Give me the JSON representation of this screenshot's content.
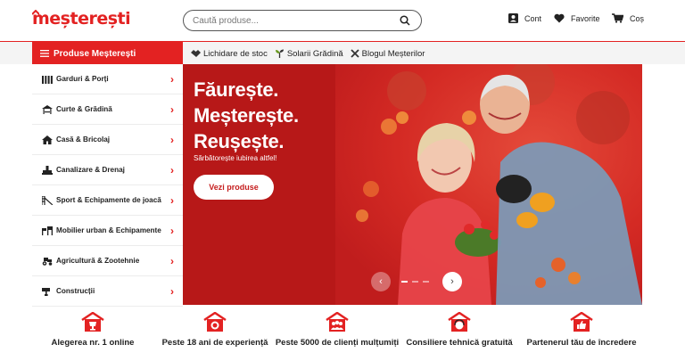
{
  "header": {
    "logo_text": "meșterești",
    "search_placeholder": "Caută produse...",
    "links": {
      "account": "Cont",
      "favorites": "Favorite",
      "cart": "Coș"
    }
  },
  "nav": {
    "categories_button": "Produse Meșterești",
    "links": [
      "Lichidare de stoc",
      "Solarii Grădină",
      "Blogul Meșterilor"
    ]
  },
  "sidebar": {
    "items": [
      {
        "label": "Garduri & Porți",
        "icon": "fence-icon"
      },
      {
        "label": "Curte & Grădină",
        "icon": "gazebo-icon"
      },
      {
        "label": "Casă & Bricolaj",
        "icon": "house-icon"
      },
      {
        "label": "Canalizare & Drenaj",
        "icon": "pipe-icon"
      },
      {
        "label": "Sport & Echipamente de joacă",
        "icon": "playground-icon"
      },
      {
        "label": "Mobilier urban & Echipamente",
        "icon": "bench-icon"
      },
      {
        "label": "Agricultură & Zootehnie",
        "icon": "tractor-icon"
      },
      {
        "label": "Construcții",
        "icon": "trowel-icon"
      }
    ]
  },
  "hero": {
    "title_lines": [
      "Făurește.",
      "Meșterește.",
      "Reușește."
    ],
    "subtitle": "Sărbătorește iubirea altfel!",
    "button": "Vezi produse",
    "slides": 3,
    "active_slide": 1
  },
  "features": [
    {
      "label": "Alegerea nr. 1 online",
      "icon": "trophy-icon"
    },
    {
      "label": "Peste 18 ani de experiență",
      "icon": "medal-icon"
    },
    {
      "label": "Peste 5000 de clienți mulțumiți",
      "icon": "people-icon"
    },
    {
      "label": "Consiliere tehnică gratuită",
      "icon": "support-icon"
    },
    {
      "label": "Partenerul tău de încredere",
      "icon": "thumbs-up-icon"
    }
  ],
  "colors": {
    "brand_red": "#e32222",
    "hero_dark": "#b71818"
  }
}
